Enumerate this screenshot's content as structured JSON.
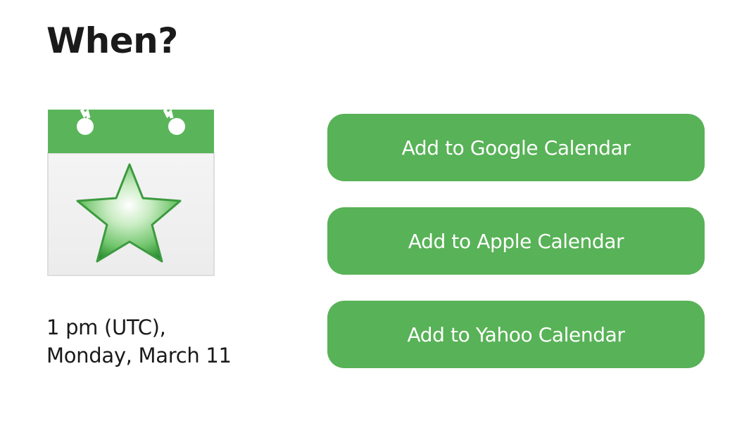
{
  "section": {
    "heading": "When?"
  },
  "event": {
    "time_line": "1 pm (UTC),",
    "date_line": "Monday, March 11"
  },
  "icon": {
    "name": "calendar-star-icon",
    "accent": "#58b257"
  },
  "buttons": {
    "google_label": "Add to Google Calendar",
    "apple_label": "Add to Apple Calendar",
    "yahoo_label": "Add to Yahoo Calendar"
  },
  "colors": {
    "button_bg": "#58b257",
    "button_text": "#ffffff",
    "heading_text": "#1a1a1a"
  }
}
